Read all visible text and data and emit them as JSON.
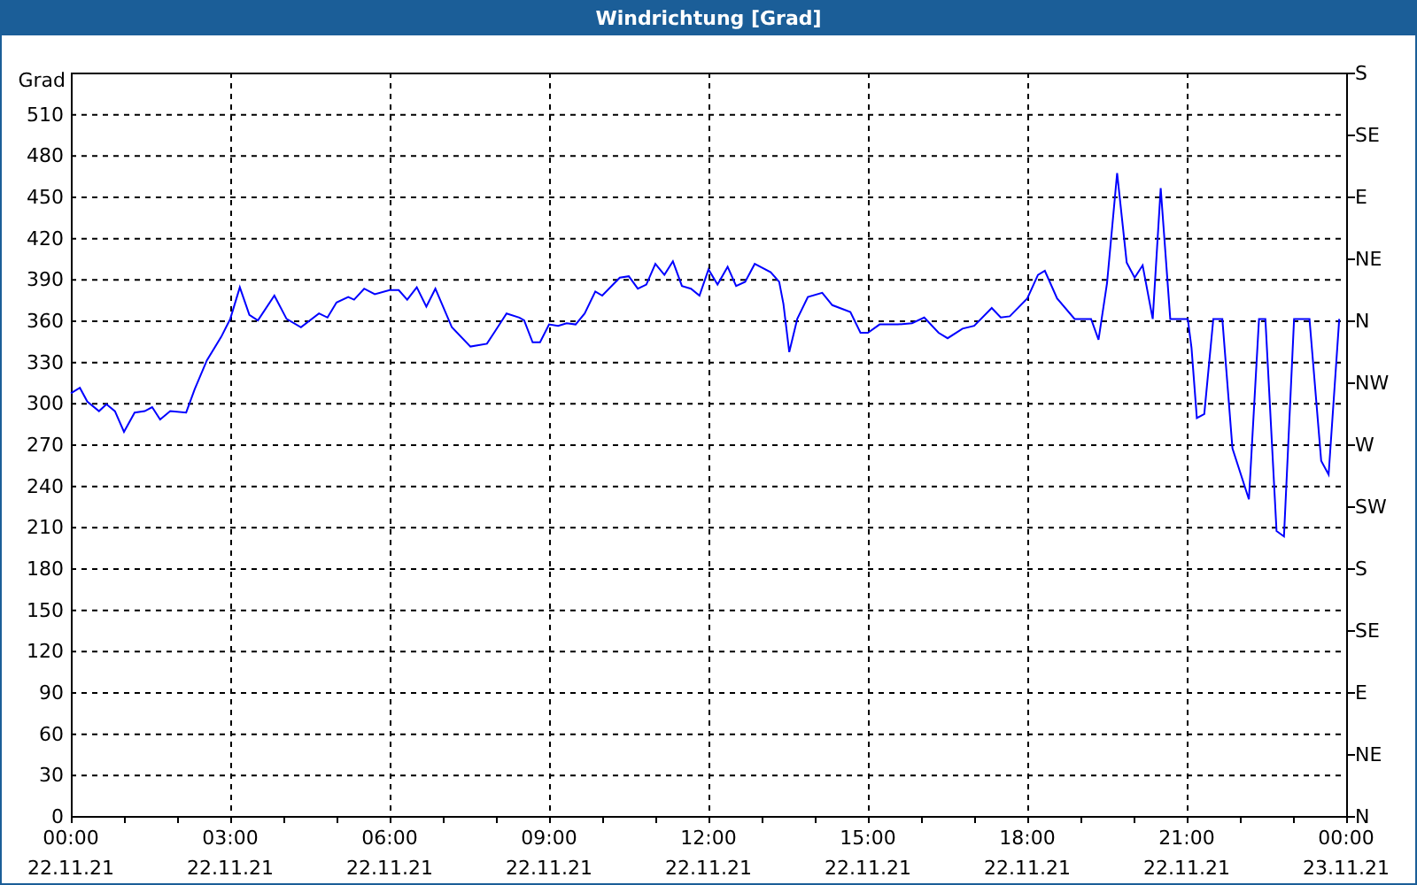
{
  "window": {
    "title": "Windrichtung [Grad]"
  },
  "chart": {
    "chart_data": {
      "type": "line",
      "ylabel": "Grad",
      "x": [
        0,
        0.17,
        0.31,
        0.53,
        0.67,
        0.83,
        1.0,
        1.2,
        1.39,
        1.53,
        1.68,
        1.87,
        2.17,
        2.33,
        2.56,
        2.83,
        3.0,
        3.18,
        3.36,
        3.52,
        3.83,
        4.06,
        4.33,
        4.67,
        4.83,
        5.0,
        5.22,
        5.33,
        5.52,
        5.72,
        6.0,
        6.17,
        6.33,
        6.51,
        6.69,
        6.86,
        7.17,
        7.52,
        7.83,
        8.0,
        8.2,
        8.44,
        8.53,
        8.69,
        8.83,
        9.0,
        9.17,
        9.33,
        9.5,
        9.67,
        9.87,
        10.0,
        10.33,
        10.5,
        10.67,
        10.83,
        11.0,
        11.17,
        11.33,
        11.5,
        11.67,
        11.83,
        12.0,
        12.17,
        12.36,
        12.52,
        12.69,
        12.87,
        13.17,
        13.33,
        13.41,
        13.52,
        13.67,
        13.87,
        14.14,
        14.33,
        14.67,
        14.86,
        15.0,
        15.22,
        15.56,
        15.83,
        16.06,
        16.33,
        16.5,
        16.78,
        17.0,
        17.33,
        17.5,
        17.67,
        18.0,
        18.2,
        18.33,
        18.56,
        18.89,
        19.2,
        19.34,
        19.5,
        19.69,
        19.87,
        20.02,
        20.17,
        20.36,
        20.51,
        20.69,
        21.02,
        21.09,
        21.19,
        21.33,
        21.5,
        21.67,
        21.86,
        22.17,
        22.36,
        22.48,
        22.69,
        22.83,
        23.02,
        23.31,
        23.53,
        23.67,
        23.87
      ],
      "series": [
        {
          "color": "#0000ff",
          "values": [
            307,
            311,
            301,
            294,
            299,
            294,
            279,
            293,
            294,
            297,
            288,
            294,
            293,
            310,
            331,
            348,
            361,
            384,
            364,
            360,
            378,
            361,
            355,
            365,
            362,
            373,
            377,
            375,
            383,
            379,
            382,
            382,
            375,
            384,
            370,
            383,
            355,
            341,
            343,
            353,
            365,
            362,
            360,
            344,
            344,
            357,
            356,
            358,
            357,
            365,
            381,
            378,
            391,
            392,
            383,
            386,
            401,
            393,
            403,
            385,
            383,
            378,
            397,
            386,
            399,
            385,
            388,
            401,
            395,
            388,
            372,
            337,
            361,
            377,
            380,
            371,
            366,
            351,
            351,
            357,
            357,
            358,
            362,
            351,
            347,
            354,
            356,
            369,
            362,
            363,
            376,
            393,
            396,
            376,
            361,
            361,
            346,
            387,
            467,
            402,
            391,
            400,
            361,
            456,
            361,
            361,
            340,
            289,
            292,
            361,
            361,
            267,
            230,
            361,
            361,
            207,
            203,
            361,
            361,
            258,
            248,
            361
          ]
        }
      ],
      "xlim": [
        0,
        24
      ],
      "ylim": [
        0,
        540
      ],
      "grid": true,
      "xticks": [
        {
          "value": 0,
          "label": "00:00"
        },
        {
          "value": 3,
          "label": "03:00"
        },
        {
          "value": 6,
          "label": "06:00"
        },
        {
          "value": 9,
          "label": "09:00"
        },
        {
          "value": 12,
          "label": "12:00"
        },
        {
          "value": 15,
          "label": "15:00"
        },
        {
          "value": 18,
          "label": "18:00"
        },
        {
          "value": 21,
          "label": "21:00"
        },
        {
          "value": 24,
          "label": "00:00"
        }
      ],
      "yticks": [
        0,
        30,
        60,
        90,
        120,
        150,
        180,
        210,
        240,
        270,
        300,
        330,
        360,
        390,
        420,
        450,
        480,
        510
      ]
    },
    "x_date_labels": [
      "22.11.21",
      "22.11.21",
      "22.11.21",
      "22.11.21",
      "22.11.21",
      "22.11.21",
      "22.11.21",
      "22.11.21",
      "23.11.21"
    ],
    "right_axis_labels": [
      "S",
      "SE",
      "E",
      "NE",
      "N",
      "NW",
      "W",
      "SW",
      "S",
      "SE",
      "E",
      "NE",
      "N"
    ]
  }
}
